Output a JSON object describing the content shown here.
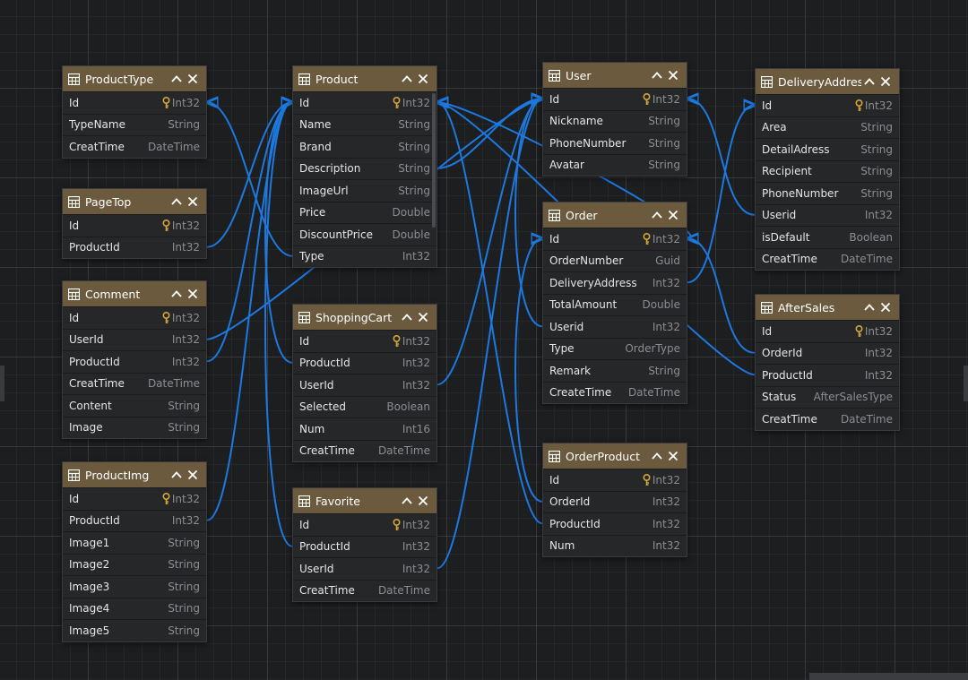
{
  "entities": {
    "producttype": {
      "title": "ProductType",
      "fields": [
        {
          "name": "Id",
          "type": "Int32",
          "key": true
        },
        {
          "name": "TypeName",
          "type": "String"
        },
        {
          "name": "CreatTime",
          "type": "DateTime"
        }
      ]
    },
    "pagetop": {
      "title": "PageTop",
      "fields": [
        {
          "name": "Id",
          "type": "Int32",
          "key": true
        },
        {
          "name": "ProductId",
          "type": "Int32"
        }
      ]
    },
    "comment": {
      "title": "Comment",
      "fields": [
        {
          "name": "Id",
          "type": "Int32",
          "key": true
        },
        {
          "name": "UserId",
          "type": "Int32"
        },
        {
          "name": "ProductId",
          "type": "Int32"
        },
        {
          "name": "CreatTime",
          "type": "DateTime"
        },
        {
          "name": "Content",
          "type": "String"
        },
        {
          "name": "Image",
          "type": "String"
        }
      ]
    },
    "productimg": {
      "title": "ProductImg",
      "fields": [
        {
          "name": "Id",
          "type": "Int32",
          "key": true
        },
        {
          "name": "ProductId",
          "type": "Int32"
        },
        {
          "name": "Image1",
          "type": "String"
        },
        {
          "name": "Image2",
          "type": "String"
        },
        {
          "name": "Image3",
          "type": "String"
        },
        {
          "name": "Image4",
          "type": "String"
        },
        {
          "name": "Image5",
          "type": "String"
        }
      ]
    },
    "product": {
      "title": "Product",
      "fields": [
        {
          "name": "Id",
          "type": "Int32",
          "key": true
        },
        {
          "name": "Name",
          "type": "String"
        },
        {
          "name": "Brand",
          "type": "String"
        },
        {
          "name": "Description",
          "type": "String"
        },
        {
          "name": "ImageUrl",
          "type": "String"
        },
        {
          "name": "Price",
          "type": "Double"
        },
        {
          "name": "DiscountPrice",
          "type": "Double"
        },
        {
          "name": "Type",
          "type": "Int32"
        }
      ]
    },
    "shoppingcart": {
      "title": "ShoppingCart",
      "fields": [
        {
          "name": "Id",
          "type": "Int32",
          "key": true
        },
        {
          "name": "ProductId",
          "type": "Int32"
        },
        {
          "name": "UserId",
          "type": "Int32"
        },
        {
          "name": "Selected",
          "type": "Boolean"
        },
        {
          "name": "Num",
          "type": "Int16"
        },
        {
          "name": "CreatTime",
          "type": "DateTime"
        }
      ]
    },
    "favorite": {
      "title": "Favorite",
      "fields": [
        {
          "name": "Id",
          "type": "Int32",
          "key": true
        },
        {
          "name": "ProductId",
          "type": "Int32"
        },
        {
          "name": "UserId",
          "type": "Int32"
        },
        {
          "name": "CreatTime",
          "type": "DateTime"
        }
      ]
    },
    "user": {
      "title": "User",
      "fields": [
        {
          "name": "Id",
          "type": "Int32",
          "key": true
        },
        {
          "name": "Nickname",
          "type": "String"
        },
        {
          "name": "PhoneNumber",
          "type": "String"
        },
        {
          "name": "Avatar",
          "type": "String"
        }
      ]
    },
    "order": {
      "title": "Order",
      "fields": [
        {
          "name": "Id",
          "type": "Int32",
          "key": true
        },
        {
          "name": "OrderNumber",
          "type": "Guid"
        },
        {
          "name": "DeliveryAddress",
          "type": "Int32"
        },
        {
          "name": "TotalAmount",
          "type": "Double"
        },
        {
          "name": "Userid",
          "type": "Int32"
        },
        {
          "name": "Type",
          "type": "OrderType"
        },
        {
          "name": "Remark",
          "type": "String"
        },
        {
          "name": "CreateTime",
          "type": "DateTime"
        }
      ]
    },
    "orderproduct": {
      "title": "OrderProduct",
      "fields": [
        {
          "name": "Id",
          "type": "Int32",
          "key": true
        },
        {
          "name": "OrderId",
          "type": "Int32"
        },
        {
          "name": "ProductId",
          "type": "Int32"
        },
        {
          "name": "Num",
          "type": "Int32"
        }
      ]
    },
    "deliveryaddress": {
      "title": "DeliveryAddress",
      "fields": [
        {
          "name": "Id",
          "type": "Int32",
          "key": true
        },
        {
          "name": "Area",
          "type": "String"
        },
        {
          "name": "DetailAdress",
          "type": "String"
        },
        {
          "name": "Recipient",
          "type": "String"
        },
        {
          "name": "PhoneNumber",
          "type": "String"
        },
        {
          "name": "Userid",
          "type": "Int32"
        },
        {
          "name": "isDefault",
          "type": "Boolean"
        },
        {
          "name": "CreatTime",
          "type": "DateTime"
        }
      ]
    },
    "aftersales": {
      "title": "AfterSales",
      "fields": [
        {
          "name": "Id",
          "type": "Int32",
          "key": true
        },
        {
          "name": "OrderId",
          "type": "Int32"
        },
        {
          "name": "ProductId",
          "type": "Int32"
        },
        {
          "name": "Status",
          "type": "AfterSalesType"
        },
        {
          "name": "CreatTime",
          "type": "DateTime"
        }
      ]
    }
  },
  "icons": {
    "table": "table-icon",
    "collapse": "chevron-up-icon",
    "close": "close-icon",
    "primary_key": "key-icon"
  },
  "colors": {
    "canvas": "#1d1e20",
    "header": "#6b5a3e",
    "connector": "#1c79e0",
    "key": "#d4a63a",
    "field_text": "#e6e6e6",
    "type_text": "#8b8d91"
  }
}
